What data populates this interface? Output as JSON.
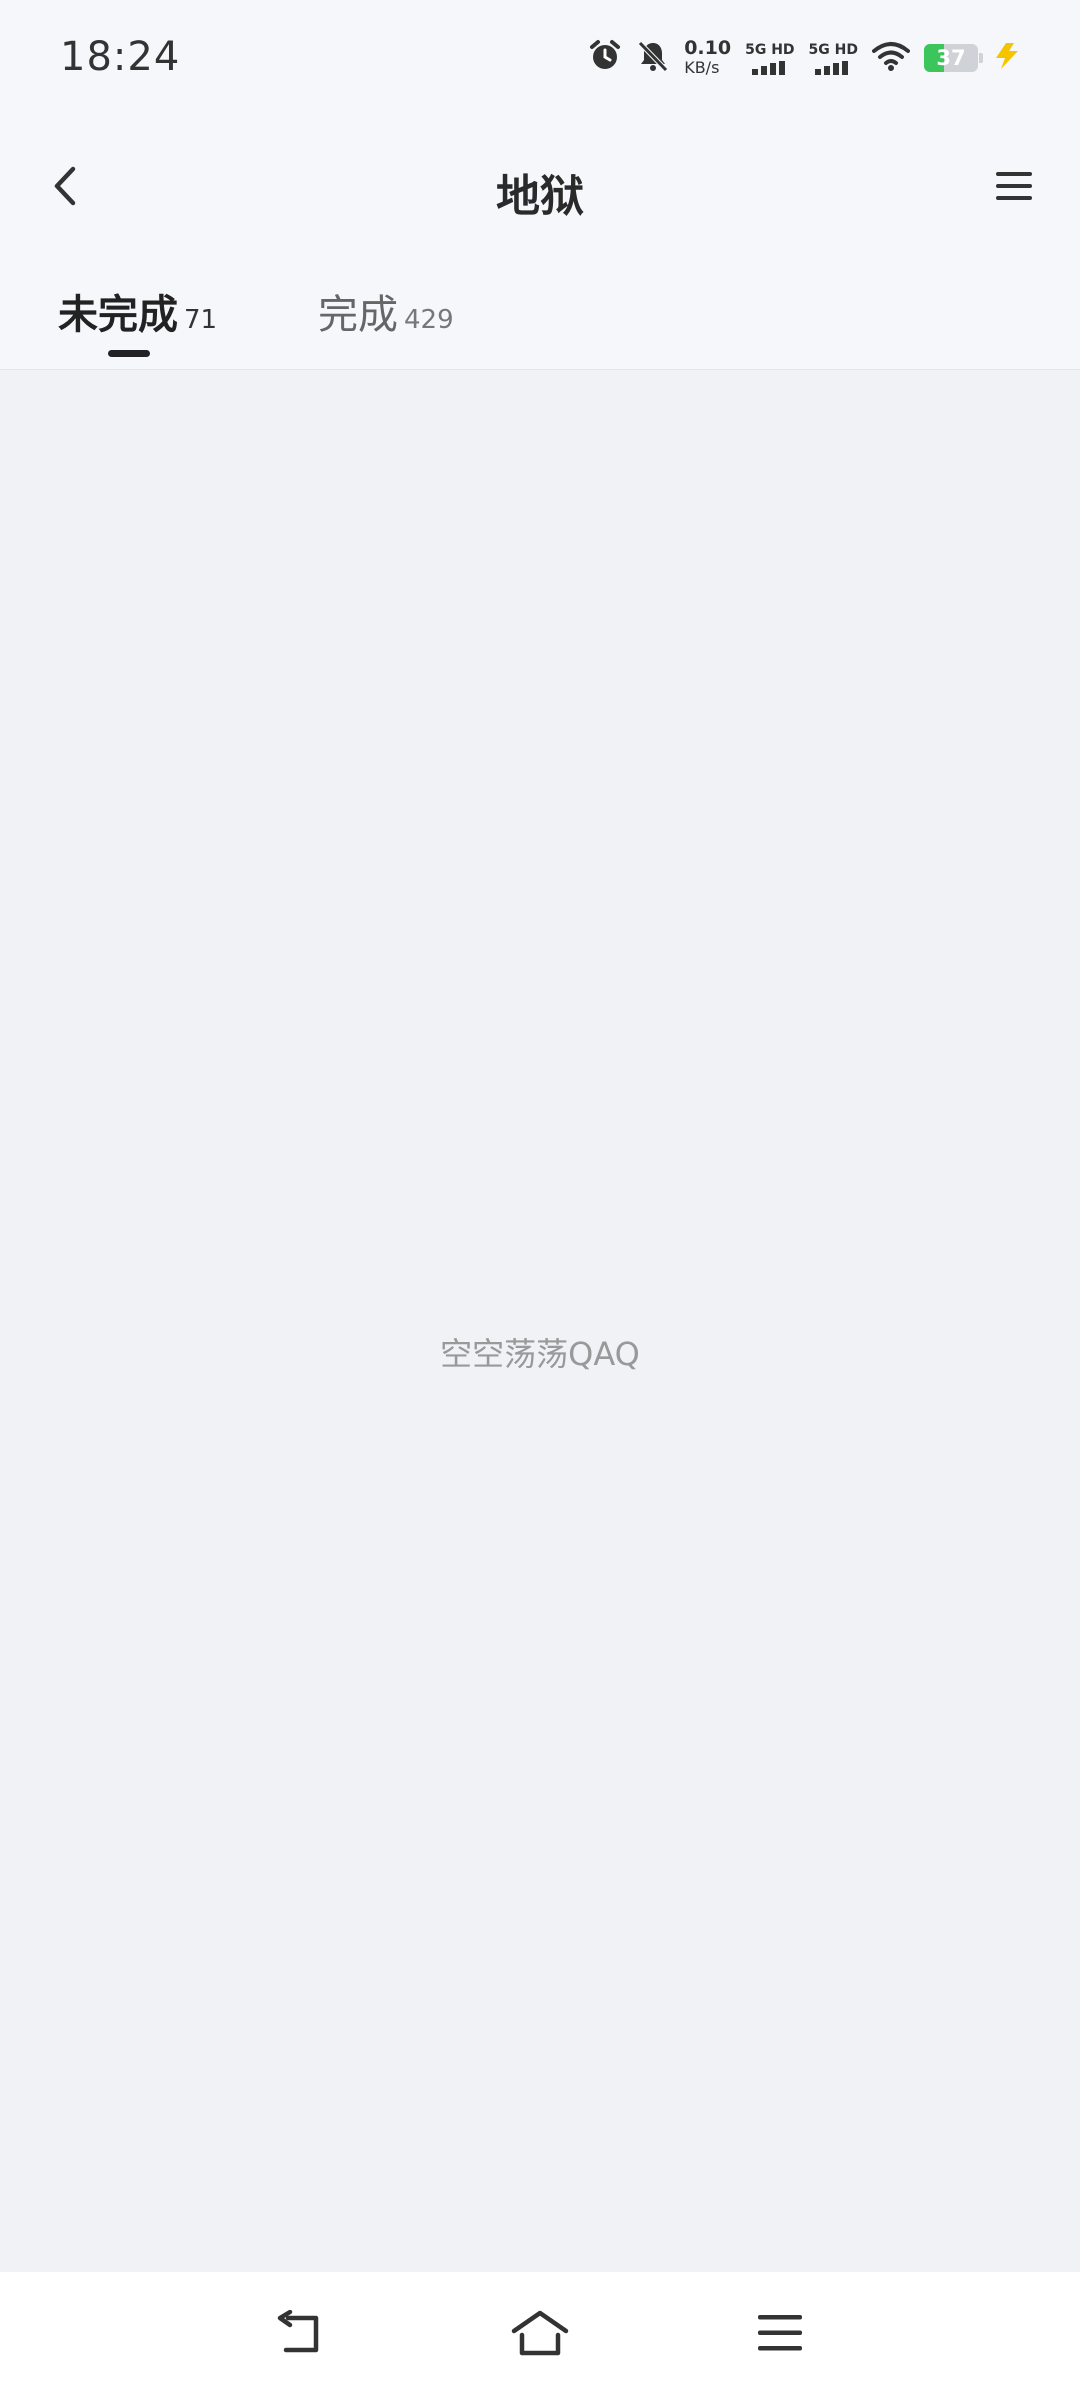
{
  "status_bar": {
    "time": "18:24",
    "net_speed_value": "0.10",
    "net_speed_unit": "KB/s",
    "sim1_label": "5G HD",
    "sim2_label": "5G HD",
    "battery_level": "37",
    "battery_fraction": 0.37,
    "icons": [
      "alarm-icon",
      "mute-icon",
      "signal-icon",
      "signal-icon",
      "wifi-icon",
      "battery-icon",
      "charging-icon"
    ]
  },
  "header": {
    "title": "地狱",
    "back_icon": "chevron-left-icon",
    "menu_icon": "hamburger-menu-icon"
  },
  "tabs": [
    {
      "label": "未完成",
      "count": "71",
      "active": true
    },
    {
      "label": "完成",
      "count": "429",
      "active": false
    }
  ],
  "main": {
    "empty_message": "空空荡荡QAQ"
  },
  "nav_bar": {
    "icons": [
      "back-nav-icon",
      "home-nav-icon",
      "recent-apps-icon"
    ]
  },
  "colors": {
    "header_bg": "#f6f7fb",
    "content_bg": "#f0f2f6",
    "battery_green": "#3cc55a",
    "charging_yellow": "#f5c400"
  }
}
